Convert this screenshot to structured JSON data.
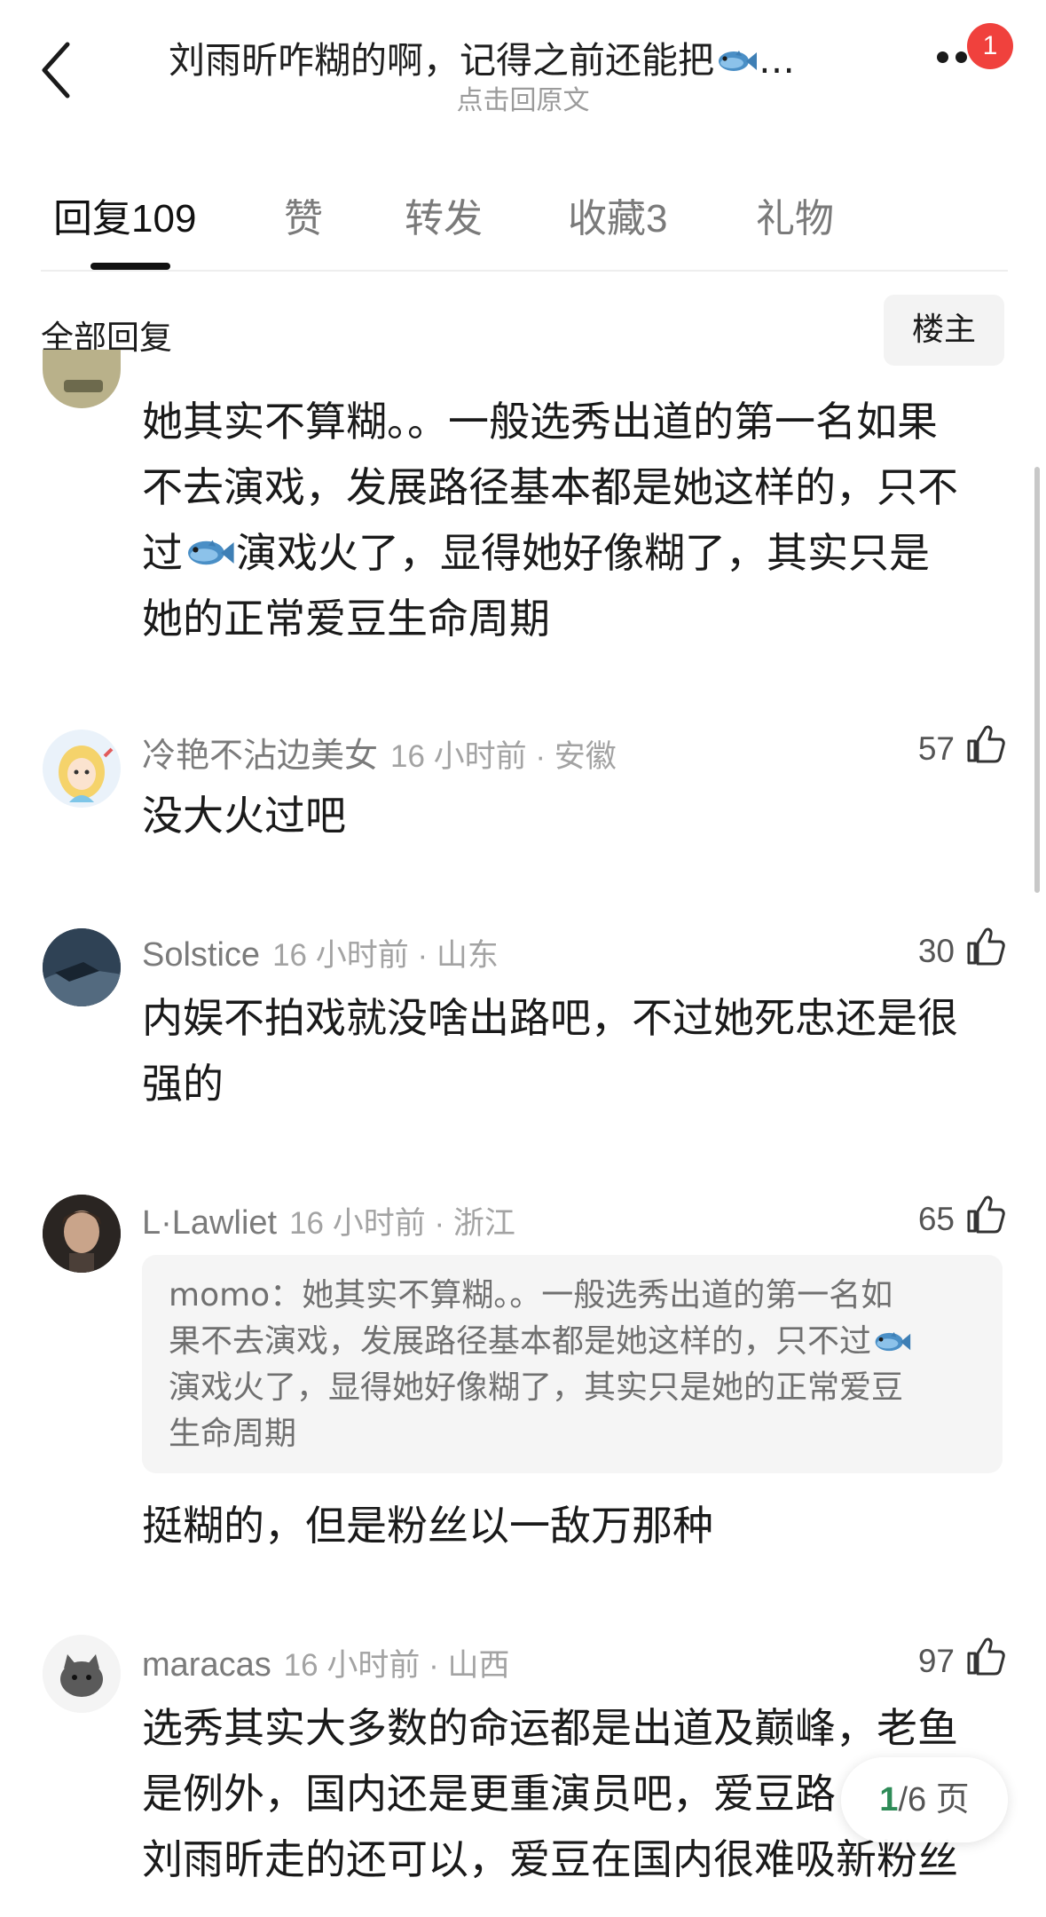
{
  "header": {
    "title": "刘雨昕咋糊的啊，记得之前还能把🐟…",
    "title_prefix": "刘雨昕咋糊的啊，记得之前还能把",
    "title_suffix": "…",
    "subtitle": "点击回原文",
    "notification_count": "1"
  },
  "tabs": [
    {
      "label": "回复",
      "count": "109"
    },
    {
      "label": "赞",
      "count": ""
    },
    {
      "label": "转发",
      "count": ""
    },
    {
      "label": "收藏",
      "count": "3"
    },
    {
      "label": "礼物",
      "count": ""
    }
  ],
  "subheader": {
    "all_replies": "全部回复",
    "op_button": "楼主"
  },
  "top_comment": {
    "lines": [
      "她其实不算糊。。一般选秀出道的第一名如果",
      "不去演戏，发展路径基本都是她这样的，只不",
      "过",
      "演戏火了，显得她好像糊了，其实只是",
      "她的正常爱豆生命周期"
    ]
  },
  "comments": [
    {
      "name": "冷艳不沾边美女",
      "time": "16 小时前 · 安徽",
      "likes": "57",
      "lines": [
        "没大火过吧"
      ]
    },
    {
      "name": "Solstice",
      "time": "16 小时前 · 山东",
      "likes": "30",
      "lines": [
        "内娱不拍戏就没啥出路吧，不过她死忠还是很",
        "强的"
      ]
    },
    {
      "name": "L·Lawliet",
      "time": "16 小时前 · 浙江",
      "likes": "65",
      "quote": [
        "momo：她其实不算糊。。一般选秀出道的第一名如",
        "果不去演戏，发展路径基本都是她这样的，只不过",
        "演戏火了，显得她好像糊了，其实只是她的正常爱豆",
        "生命周期"
      ],
      "lines": [
        "挺糊的，但是粉丝以一敌万那种"
      ]
    },
    {
      "name": "maracas",
      "time": "16 小时前 · 山西",
      "likes": "97",
      "lines": [
        "选秀其实大多数的命运都是出道及巅峰，老鱼",
        "是例外，国内还是更重演员吧，爱豆路",
        "刘雨昕走的还可以，爱豆在国内很难吸新粉丝"
      ]
    }
  ],
  "pagination": {
    "current": "1",
    "total": "/6 页"
  },
  "icons": [
    "back-arrow-icon",
    "more-icon",
    "fish-emoji-icon",
    "thumbs-up-icon"
  ],
  "colors": {
    "badge": "#f0413d",
    "page_current": "#2e8b57"
  }
}
